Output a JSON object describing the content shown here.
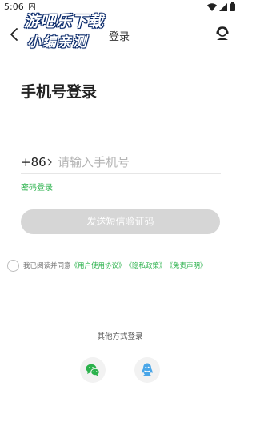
{
  "status_bar": {
    "time": "5:06",
    "notification_letter": "A"
  },
  "watermark": {
    "line1": "游吧乐下载",
    "line2": "小编亲测"
  },
  "nav": {
    "title": "登录"
  },
  "page": {
    "title": "手机号登录"
  },
  "phone": {
    "country_code": "+86",
    "placeholder": "请输入手机号",
    "value": ""
  },
  "password_login_label": "密码登录",
  "send_code_label": "发送短信验证码",
  "agreement": {
    "prefix": "我已阅读并同意",
    "user_agreement": "《用户使用协议》",
    "privacy_policy": "《隐私政策》",
    "disclaimer": "《免责声明》"
  },
  "other_login": {
    "label": "其他方式登录"
  },
  "colors": {
    "accent_green": "#2bb24c",
    "button_disabled": "#d6d6d6",
    "wechat_green": "#2bb24c",
    "qq_blue": "#4aa6e8"
  },
  "icons": {
    "back": "back-arrow-icon",
    "service": "customer-service-icon",
    "wechat": "wechat-icon",
    "qq": "qq-icon"
  }
}
